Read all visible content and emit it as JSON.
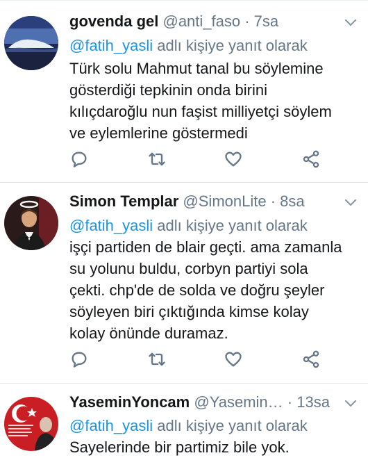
{
  "tweets": [
    {
      "name": "govenda gel",
      "handle": "@anti_faso",
      "time": "· 7sa",
      "reply_mention": "@fatih_yasli",
      "reply_text": "adlı kişiye yanıt olarak",
      "body_lines": [
        "Türk solu Mahmut tanal bu söylemine",
        "gösterdiği tepkinin onda birini",
        "kılıçdaroğlu nun faşist milliyetçi söylem",
        "ve eylemlerine göstermedi"
      ],
      "avatar_icon": "mountain-landscape-avatar"
    },
    {
      "name": "Simon Templar",
      "handle": "@SimonLite",
      "time": "· 8sa",
      "reply_mention": "@fatih_yasli",
      "reply_text": "adlı kişiye yanıt olarak",
      "body_lines": [
        "işçi partiden de blair geçti. ama zamanla",
        "su yolunu buldu, corbyn partiyi sola",
        "çekti. chp'de de solda ve doğru şeyler",
        "söyleyen biri çıktığında kimse kolay",
        "kolay önünde duramaz."
      ],
      "avatar_icon": "man-with-halo-avatar"
    },
    {
      "name": "YaseminYoncam",
      "handle": "@Yasemin…",
      "time": "· 13sa",
      "reply_mention": "@fatih_yasli",
      "reply_text": "adlı kişiye yanıt olarak",
      "body_lines": [
        "Sayelerinde bir partimiz bile yok."
      ],
      "avatar_icon": "flag-portrait-avatar"
    }
  ],
  "icons": {
    "reply": "reply-icon",
    "retweet": "retweet-icon",
    "like": "heart-icon",
    "share": "share-icon",
    "menu": "chevron-down-icon"
  },
  "colors": {
    "mention": "#1b95e0",
    "meta": "#657786",
    "icon": "#657786",
    "divider": "#e1e8ed"
  }
}
